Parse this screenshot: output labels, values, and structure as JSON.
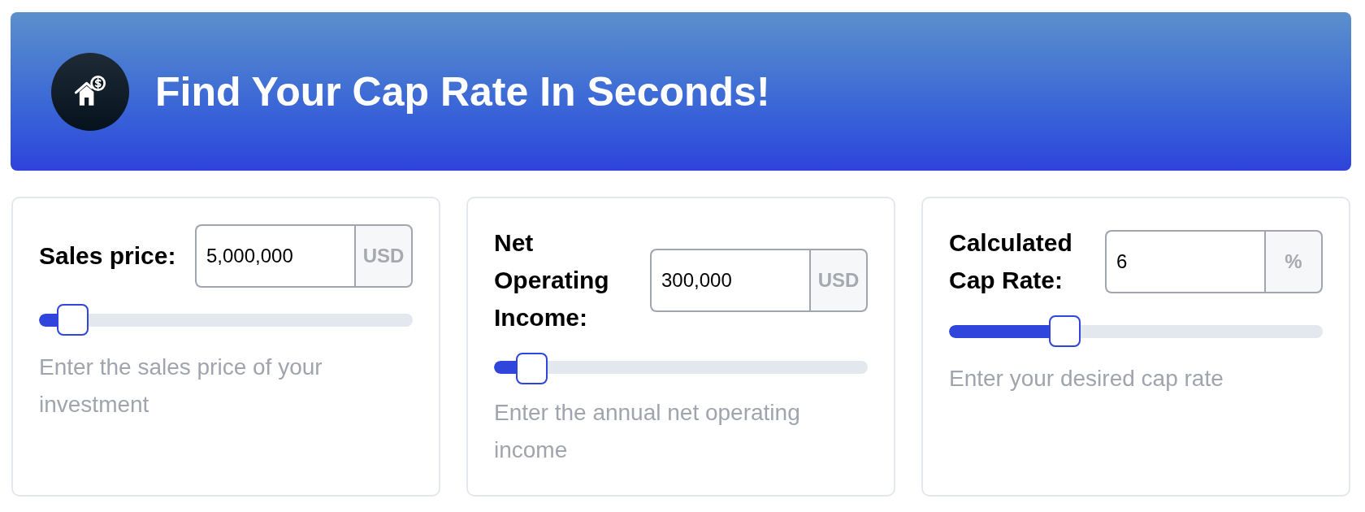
{
  "header": {
    "title": "Find Your Cap Rate In Seconds!"
  },
  "fields": [
    {
      "label": "Sales price:",
      "value": "5,000,000",
      "unit": "USD",
      "level": 0.09,
      "hint": "Enter the sales price of your investment"
    },
    {
      "label": "Net Operating Income:",
      "value": "300,000",
      "unit": "USD",
      "level": 0.1,
      "hint": "Enter the annual net operating income"
    },
    {
      "label": "Calculated Cap Rate:",
      "value": "6",
      "unit": "%",
      "level": 0.31,
      "hint": "Enter your desired cap rate"
    }
  ]
}
